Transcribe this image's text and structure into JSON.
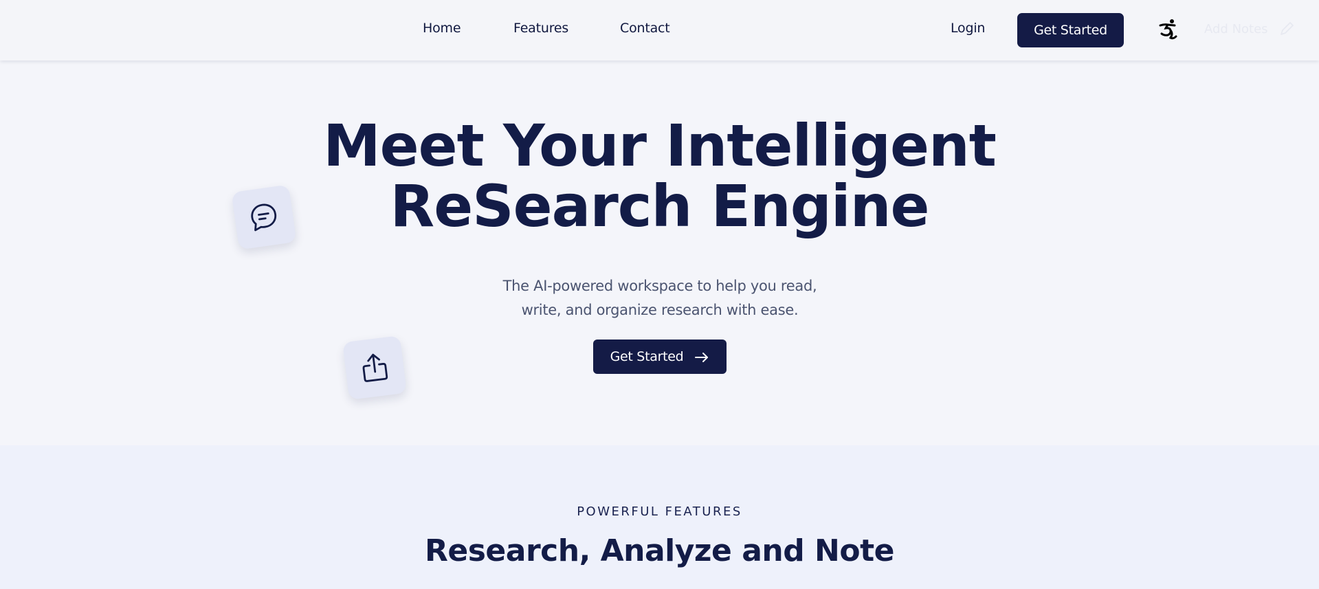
{
  "nav": {
    "links": [
      "Home",
      "Features",
      "Contact"
    ],
    "login_label": "Login",
    "cta_label": "Get Started",
    "add_notes_label": "Add Notes"
  },
  "hero": {
    "title_line1": "Meet Your Intelligent",
    "title_line2": "ReSearch Engine",
    "subtitle_line1": "The AI-powered workspace to help you read,",
    "subtitle_line2": "write, and organize research with ease.",
    "cta_label": "Get Started",
    "cta_icon": "arrow-right-icon",
    "floating_icons": [
      "chat-icon",
      "share-icon"
    ]
  },
  "features": {
    "eyebrow": "POWERFUL FEATURES",
    "title": "Research, Analyze and Note"
  },
  "colors": {
    "brand_navy": "#141b46",
    "background": "#f4f5fa",
    "section_background": "#eef1fb",
    "muted_text": "#4b5470"
  }
}
